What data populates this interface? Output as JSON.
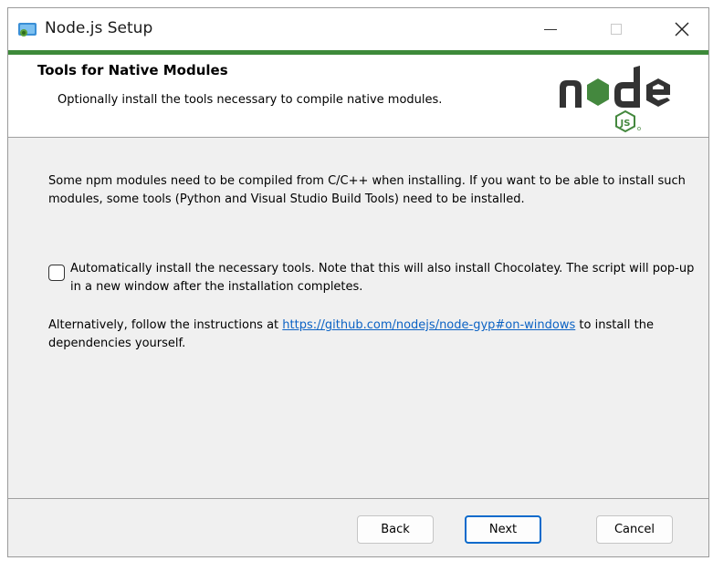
{
  "window": {
    "title": "Node.js Setup"
  },
  "banner": {
    "title": "Tools for Native Modules",
    "subtitle": "Optionally install the tools necessary to compile native modules.",
    "logo_text": "node",
    "logo_badge": "JS"
  },
  "content": {
    "paragraph1": "Some npm modules need to be compiled from C/C++ when installing. If you want to be able to install such modules, some tools (Python and Visual Studio Build Tools) need to be installed.",
    "checkbox": {
      "checked": false,
      "label": "Automatically install the necessary tools. Note that this will also install Chocolatey. The script will pop-up in a new window after the installation completes."
    },
    "paragraph3_prefix": "Alternatively, follow the instructions at ",
    "link_text": "https://github.com/nodejs/node-gyp#on-windows",
    "paragraph3_suffix": " to install the dependencies yourself."
  },
  "buttons": {
    "back": "Back",
    "next": "Next",
    "cancel": "Cancel"
  },
  "colors": {
    "accent_green": "#3d8a3a",
    "link_blue": "#0b62c4",
    "focus_blue": "#0a6acb",
    "node_dark": "#333333",
    "node_green": "#44883e"
  },
  "icons": {
    "app": "node-installer-icon",
    "minimize": "minimize-icon",
    "maximize": "maximize-icon",
    "close": "close-icon"
  }
}
